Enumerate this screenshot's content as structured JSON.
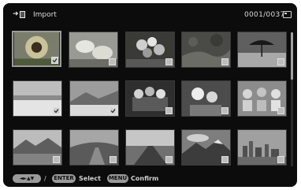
{
  "header": {
    "import_icon": "import-arrow-icon",
    "title": "Import",
    "counter": "0001/0037",
    "card_icon": "memory-card-icon"
  },
  "thumbnails": [
    {
      "subject": "sunflower",
      "checked": true,
      "selected": true
    },
    {
      "subject": "white-flowers",
      "checked": false
    },
    {
      "subject": "flower-bouquet",
      "checked": false
    },
    {
      "subject": "rocky-stream",
      "checked": false
    },
    {
      "subject": "beach-umbrella",
      "checked": false
    },
    {
      "subject": "snowy-beach",
      "checked": true
    },
    {
      "subject": "mountain-snow",
      "checked": true
    },
    {
      "subject": "flower-basket",
      "checked": false
    },
    {
      "subject": "white-flower-pot",
      "checked": false
    },
    {
      "subject": "flower-pots",
      "checked": false
    },
    {
      "subject": "mountain-lake",
      "checked": false
    },
    {
      "subject": "hill-road",
      "checked": false
    },
    {
      "subject": "open-road",
      "checked": false
    },
    {
      "subject": "mountain-clouds",
      "checked": false
    },
    {
      "subject": "city-skyline",
      "checked": false
    }
  ],
  "footer": {
    "nav_keys": "◄►▲▼",
    "slash": "/",
    "enter_key": "ENTER",
    "select_label": "Select",
    "menu_key": "MENU",
    "confirm_label": "Confirm"
  },
  "colors": {
    "background": "#0c0c0c",
    "text": "#dcdcdc",
    "key_pill": "#9a9a9a",
    "selection_border": "#9a9a9a"
  }
}
